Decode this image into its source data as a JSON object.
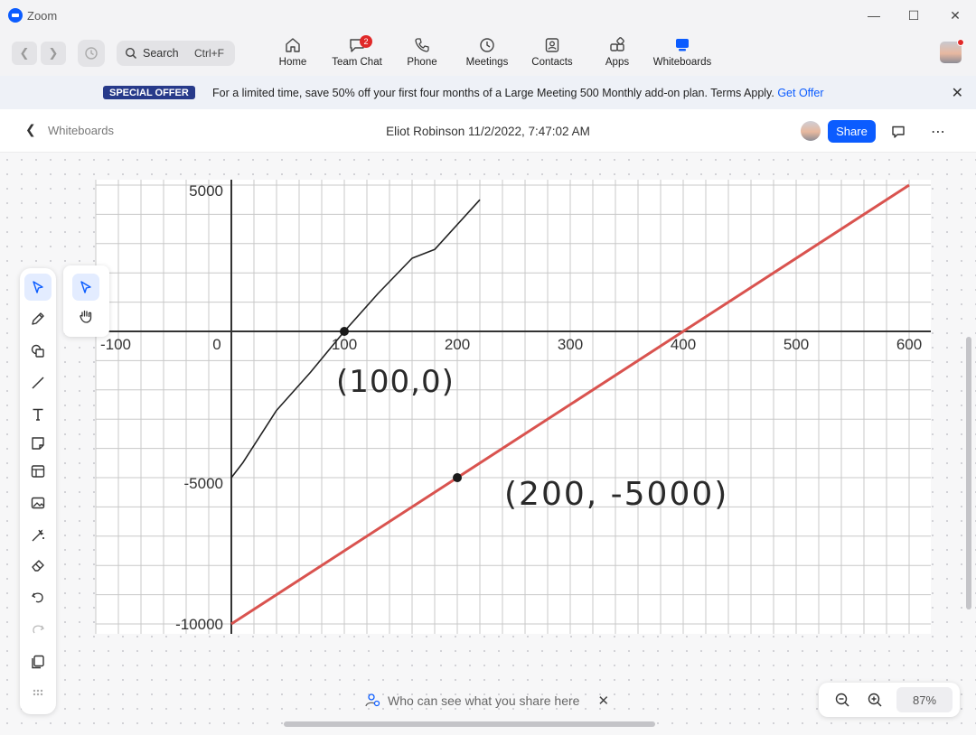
{
  "window": {
    "app_title": "Zoom"
  },
  "nav": {
    "search_placeholder": "Search",
    "search_shortcut": "Ctrl+F",
    "items": [
      {
        "label": "Home",
        "icon": "home-icon"
      },
      {
        "label": "Team Chat",
        "icon": "chat-icon",
        "badge": "2"
      },
      {
        "label": "Phone",
        "icon": "phone-icon"
      },
      {
        "label": "Meetings",
        "icon": "clock-icon"
      },
      {
        "label": "Contacts",
        "icon": "contacts-icon"
      },
      {
        "label": "Apps",
        "icon": "apps-icon"
      },
      {
        "label": "Whiteboards",
        "icon": "whiteboard-icon",
        "active": true
      }
    ]
  },
  "offer": {
    "tag": "SPECIAL OFFER",
    "text": "For a limited time, save 50% off your first four months of a Large Meeting 500 Monthly add-on plan. Terms Apply.",
    "link": "Get Offer"
  },
  "header": {
    "breadcrumb": "Whiteboards",
    "title": "Eliot Robinson 11/2/2022, 7:47:02 AM",
    "share_label": "Share"
  },
  "board": {
    "x_ticks": [
      "-100",
      "0",
      "100",
      "200",
      "300",
      "400",
      "500",
      "600"
    ],
    "y_ticks": [
      "5000",
      "-5000",
      "-10000"
    ],
    "annotation_1": "(100,0)",
    "annotation_2": "(200, -5000)"
  },
  "chart_data": {
    "type": "line",
    "xlim": [
      -120,
      620
    ],
    "ylim": [
      -10400,
      5500
    ],
    "grid": true,
    "series": [
      {
        "x": [
          0,
          10,
          40,
          70,
          100,
          130,
          160,
          180,
          220
        ],
        "y": [
          -5000,
          -4500,
          -2700,
          -1400,
          0,
          1300,
          2500,
          2800,
          4500
        ],
        "color": "#222222"
      },
      {
        "x": [
          0,
          200,
          400,
          600
        ],
        "y": [
          -10000,
          -5000,
          0,
          5000
        ],
        "color": "#d9534f"
      }
    ],
    "points": [
      {
        "x": 100,
        "y": 0
      },
      {
        "x": 200,
        "y": -5000
      }
    ]
  },
  "share_hint": "Who can see what you share here",
  "zoom": {
    "level": "87%"
  },
  "colors": {
    "accent": "#0b5cff",
    "offer_tag": "#273a8a",
    "red_line": "#d9534f"
  }
}
